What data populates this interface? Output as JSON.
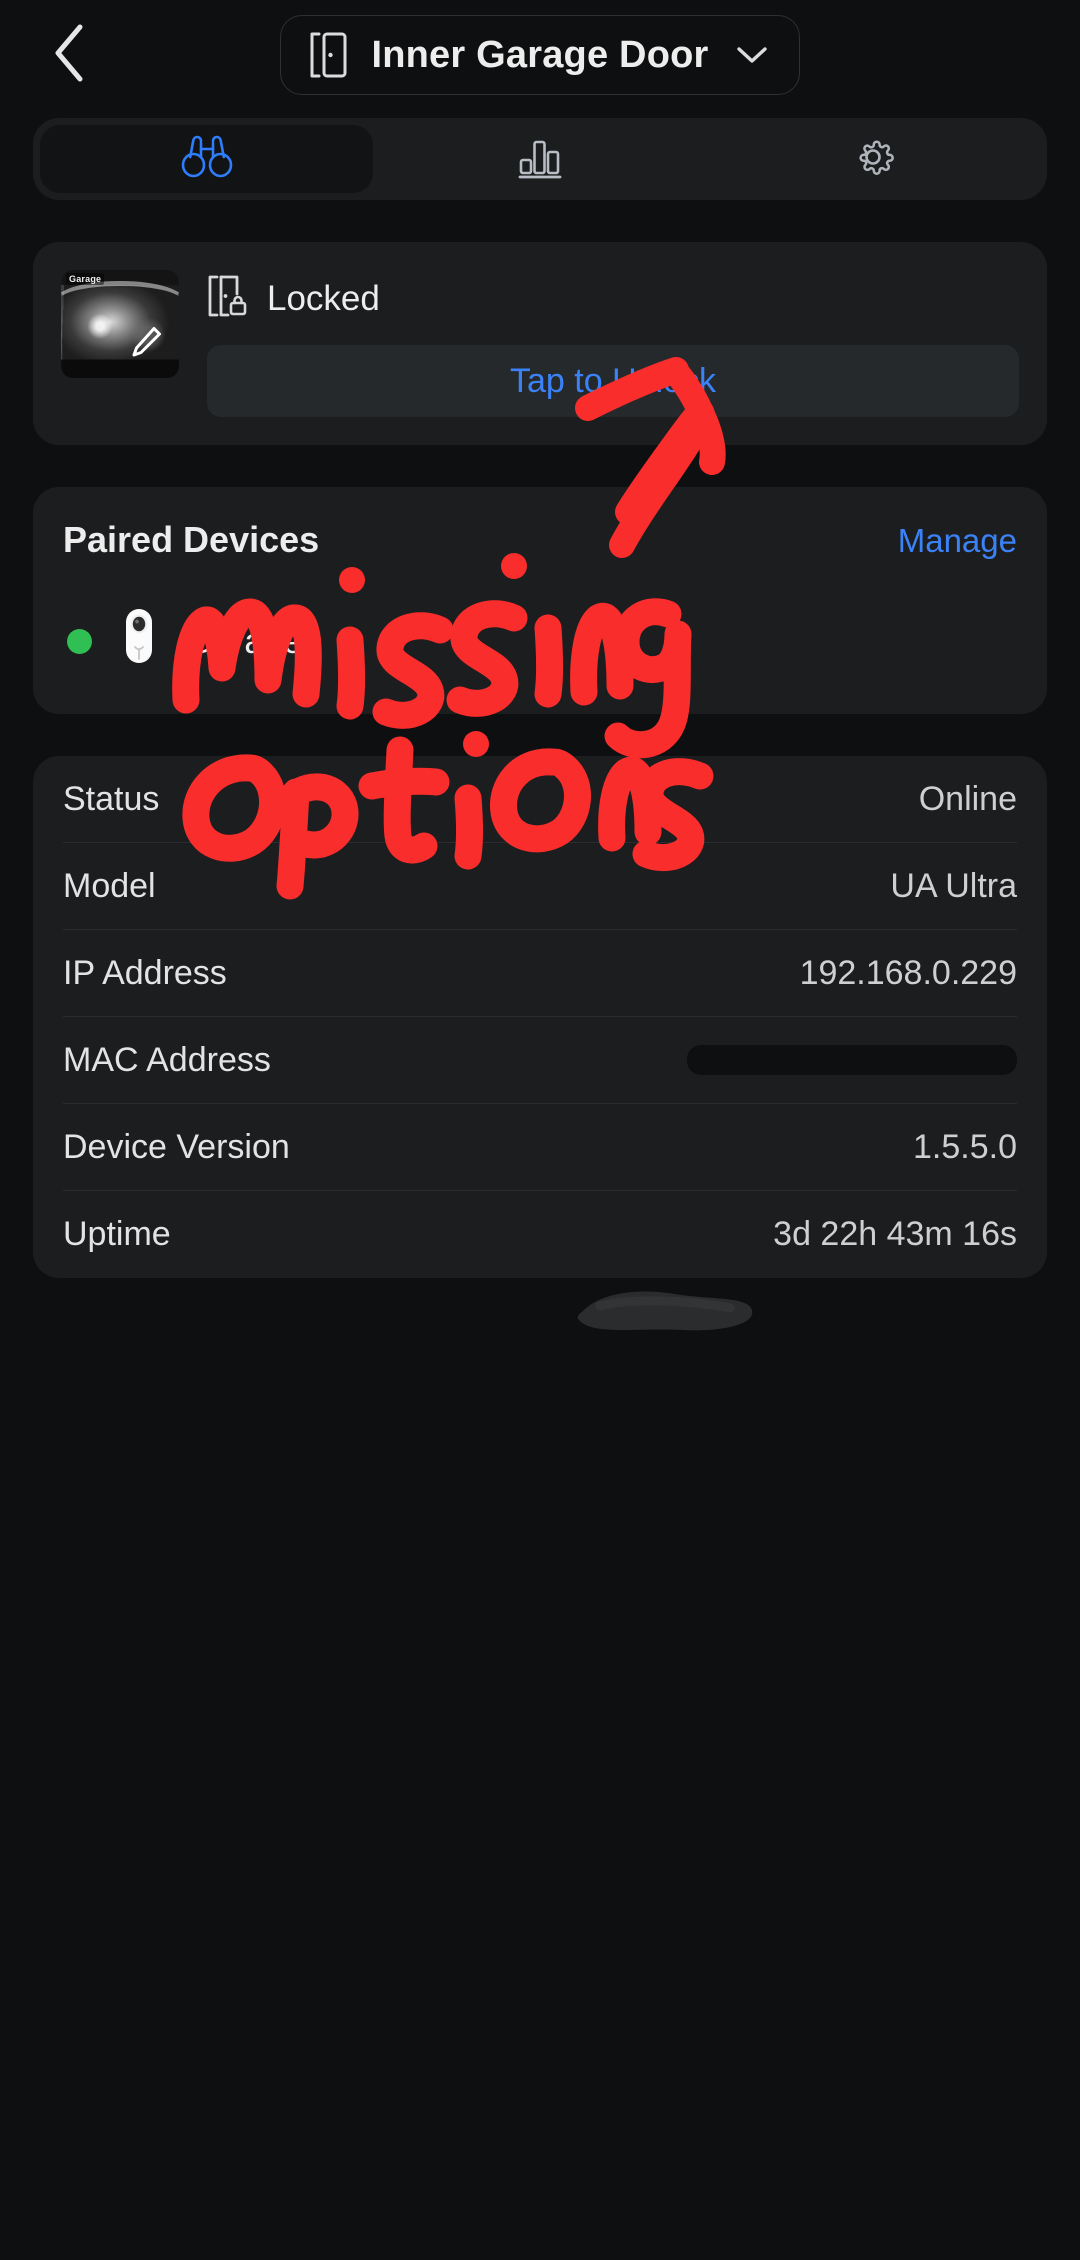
{
  "header": {
    "back_icon": "chevron-left-icon",
    "device_icon": "door-icon",
    "title": "Inner Garage Door",
    "dropdown_icon": "chevron-down-icon"
  },
  "tabs": [
    {
      "id": "live",
      "icon": "binoculars-icon",
      "active": true
    },
    {
      "id": "activity",
      "icon": "bar-chart-icon",
      "active": false
    },
    {
      "id": "settings",
      "icon": "gear-icon",
      "active": false
    }
  ],
  "lock_card": {
    "thumbnail_label": "Garage",
    "thumbnail_edit_icon": "pencil-icon",
    "status_icon": "door-lock-icon",
    "status_text": "Locked",
    "action_label": "Tap to Unlock"
  },
  "paired_devices": {
    "title": "Paired Devices",
    "manage_label": "Manage",
    "devices": [
      {
        "name": "Garage",
        "status": "online",
        "status_color": "#2fbf52",
        "icon": "camera-icon"
      }
    ]
  },
  "info": {
    "rows": [
      {
        "key": "Status",
        "value": "Online"
      },
      {
        "key": "Model",
        "value": "UA Ultra"
      },
      {
        "key": "IP Address",
        "value": "192.168.0.229"
      },
      {
        "key": "MAC Address",
        "value": "",
        "redacted": true
      },
      {
        "key": "Device Version",
        "value": "1.5.5.0"
      },
      {
        "key": "Uptime",
        "value": "3d 22h 43m 16s"
      }
    ]
  },
  "annotation": {
    "color": "#fa2d2d",
    "text_line1": "missing",
    "text_line2": "options",
    "arrow": "arrow-pointing-to-manage"
  },
  "colors": {
    "background": "#0e0f10",
    "card": "#1b1d1f",
    "accent_blue": "#3b82f6",
    "tab_active_blue": "#2e7dfa",
    "status_green": "#2fbf52",
    "annotation_red": "#fa2d2d"
  }
}
